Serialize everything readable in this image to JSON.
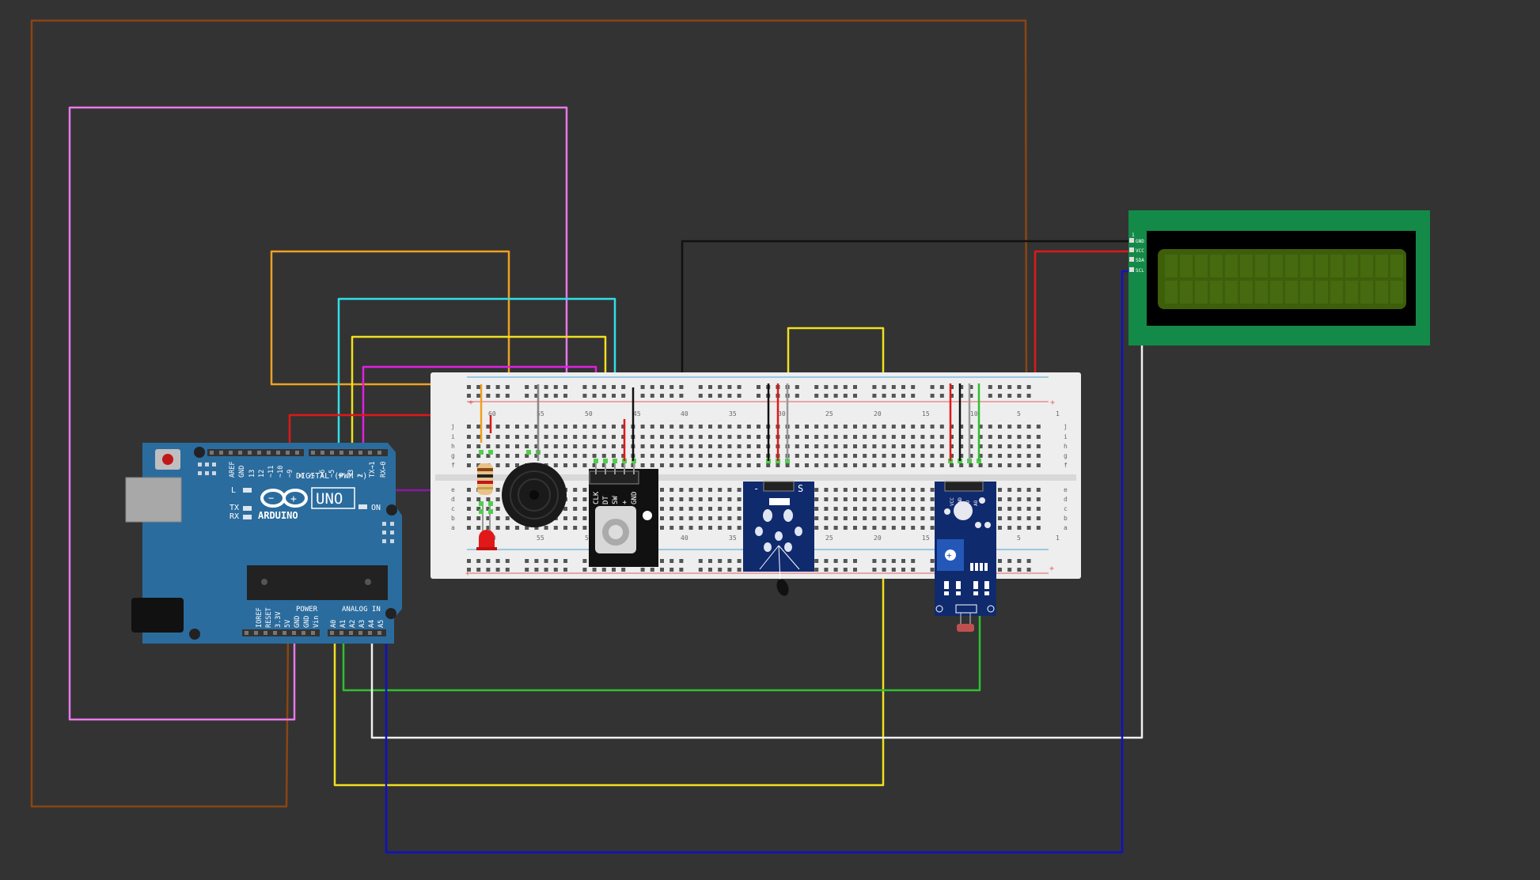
{
  "arduino": {
    "brand": "ARDUINO",
    "model": "UNO",
    "on_label": "ON",
    "tx_label": "TX",
    "rx_label": "RX",
    "l_label": "L",
    "digital_label": "DIGITAL (PWM ~)",
    "power_label": "POWER",
    "analog_label": "ANALOG IN",
    "digital_pins": [
      "AREF",
      "GND",
      "13",
      "12",
      "~11",
      "~10",
      "~9",
      "8",
      "7",
      "~6",
      "~5",
      "4",
      "~3",
      "2",
      "TX→1",
      "RX←0"
    ],
    "power_pins": [
      "IOREF",
      "RESET",
      "3.3V",
      "5V",
      "GND",
      "GND",
      "Vin"
    ],
    "analog_pins": [
      "A0",
      "A1",
      "A2",
      "A3",
      "A4",
      "A5"
    ]
  },
  "breadboard": {
    "column_numbers_top": [
      "60",
      "55",
      "50",
      "45",
      "40",
      "35",
      "30",
      "25",
      "20",
      "15",
      "10",
      "5",
      "1"
    ],
    "column_numbers_bottom": [
      "60",
      "55",
      "50",
      "45",
      "40",
      "35",
      "30",
      "25",
      "20",
      "15",
      "10",
      "5",
      "1"
    ],
    "row_letters_top": [
      "j",
      "i",
      "h",
      "g",
      "f"
    ],
    "row_letters_bottom": [
      "e",
      "d",
      "c",
      "b",
      "a"
    ],
    "plus": "+"
  },
  "encoder": {
    "pins": [
      "CLK",
      "DT",
      "SW",
      "+",
      "GND"
    ]
  },
  "temp_module": {
    "minus": "-",
    "s": "S"
  },
  "ldr_module": {
    "pins": [
      "VCC",
      "GND",
      "DO",
      "AO"
    ]
  },
  "lcd": {
    "pins": [
      "GND",
      "VCC",
      "SDA",
      "SCL"
    ],
    "pin1": "1"
  },
  "colors": {
    "background": "#333333",
    "arduino": "#2b6c9e",
    "breadboard": "#eeeeee",
    "lcd_board": "#138a47",
    "lcd_screen": "#3d5e0a",
    "module_blue": "#102a6e"
  }
}
